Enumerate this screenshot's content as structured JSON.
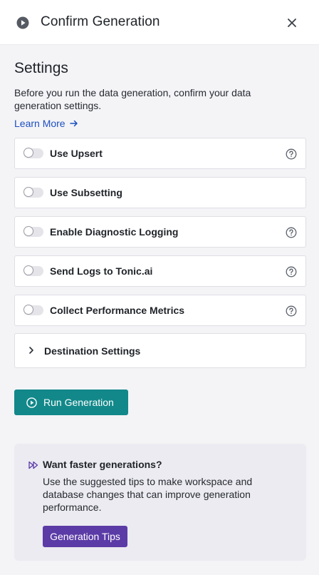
{
  "header": {
    "title": "Confirm Generation",
    "icon": "play-circle-icon",
    "close_icon": "close-icon"
  },
  "settings": {
    "title": "Settings",
    "description": "Before you run the data generation, confirm your data generation settings.",
    "learn_more_label": "Learn More",
    "items": [
      {
        "label": "Use Upsert",
        "enabled": false,
        "has_help": true
      },
      {
        "label": "Use Subsetting",
        "enabled": false,
        "has_help": false
      },
      {
        "label": "Enable Diagnostic Logging",
        "enabled": false,
        "has_help": true
      },
      {
        "label": "Send Logs to Tonic.ai",
        "enabled": false,
        "has_help": true
      },
      {
        "label": "Collect Performance Metrics",
        "enabled": false,
        "has_help": true
      }
    ],
    "destination_label": "Destination Settings"
  },
  "actions": {
    "run_label": "Run Generation"
  },
  "tips": {
    "title": "Want faster generations?",
    "body": "Use the suggested tips to make workspace and database changes that can improve generation performance.",
    "button_label": "Generation Tips"
  },
  "colors": {
    "primary_teal": "#12888a",
    "tips_purple": "#5b3ba6",
    "link_blue": "#1d4fbf"
  }
}
